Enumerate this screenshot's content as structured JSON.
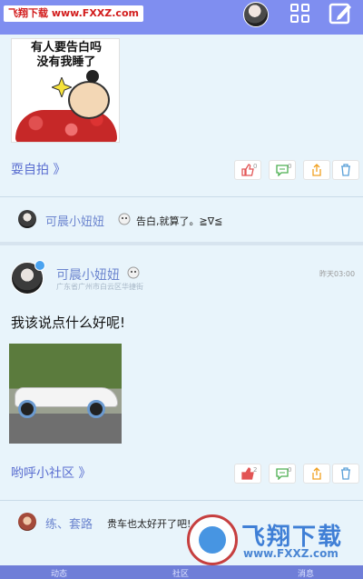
{
  "watermark": {
    "brand": "飞翔下载",
    "url": "www.FXXZ.com"
  },
  "feed": {
    "post1": {
      "image_text": "有人要告白吗\n没有我睡了",
      "tag": "耍自拍 》",
      "actions": {
        "like_count": "0",
        "comment_count": "0"
      },
      "comment": {
        "name": "可晨小妞妞",
        "text": "告白,就算了。≧∇≦"
      }
    },
    "post2": {
      "author": "可晨小妞妞",
      "location": "广东省广州市白云区华捷街",
      "time": "昨天03:00",
      "text": "我该说点什么好呢!",
      "tag": "哟呼小社区 》",
      "actions": {
        "like_count": "2",
        "comment_count": "0"
      },
      "comment": {
        "name": "练、套路",
        "text": "贵车也太好开了吧!"
      }
    }
  },
  "bottom_nav": [
    "动态",
    "社区",
    "消息"
  ],
  "colors": {
    "topbar": "#7f8ef0",
    "accent": "#6d86cf",
    "link": "#5a6ed0",
    "like": "#e25555"
  }
}
